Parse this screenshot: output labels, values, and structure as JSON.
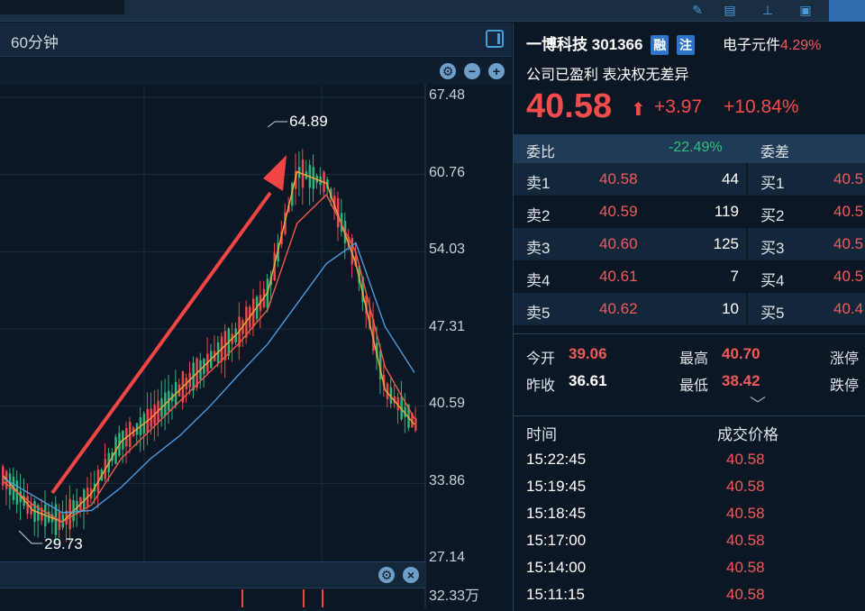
{
  "chart_panel": {
    "period": "60分钟",
    "y_ticks": [
      "67.48",
      "60.76",
      "54.03",
      "47.31",
      "40.59",
      "33.86",
      "27.14"
    ],
    "volume_tick": "32.33万",
    "annotation_high": "64.89",
    "annotation_low": "29.73"
  },
  "chart_data": {
    "type": "line",
    "title": "",
    "xlabel": "",
    "ylabel": "",
    "ylim": [
      27.14,
      67.48
    ],
    "grid": true,
    "x": [
      0,
      4,
      8,
      12,
      16,
      20,
      24,
      28,
      32,
      36,
      40,
      44,
      48,
      52,
      56
    ],
    "series": [
      {
        "values": [
          34.5,
          31.5,
          30.5,
          33.0,
          37.5,
          39.5,
          42.0,
          44.5,
          47.0,
          50.5,
          61.0,
          60.0,
          53.0,
          42.0,
          39.0
        ]
      },
      {
        "values": [
          34.0,
          32.0,
          30.5,
          32.0,
          36.0,
          38.5,
          41.0,
          43.5,
          46.0,
          49.0,
          56.5,
          59.0,
          54.0,
          44.0,
          39.5
        ]
      },
      {
        "values": [
          34.3,
          32.8,
          31.3,
          31.5,
          33.5,
          36.0,
          38.0,
          40.5,
          43.3,
          46.0,
          49.5,
          53.0,
          54.8,
          47.5,
          43.5
        ]
      }
    ],
    "annotations": [
      {
        "label": "64.89",
        "x": 36,
        "y": 64.89
      },
      {
        "label": "29.73",
        "x": 8,
        "y": 29.73
      }
    ]
  },
  "colors": {
    "up": "#e84a4a",
    "down": "#2fb47c",
    "ma_short": "#f2a83a",
    "ma_mid": "#f05a4a",
    "ma_long": "#4a9be0"
  },
  "stock": {
    "name": "一博科技",
    "code": "301366",
    "badge1": "融",
    "badge2": "注",
    "sector": "电子元件",
    "sector_pct": "4.29%",
    "status": "公司已盈利 表决权无差异",
    "price": "40.58",
    "change": "+3.97",
    "change_pct": "+10.84%"
  },
  "orderbook": {
    "ratio_label": "委比",
    "ratio_value": "-22.49%",
    "diff_label": "委差",
    "rows": [
      {
        "sell_label": "卖1",
        "sell_price": "40.58",
        "sell_vol": "44",
        "buy_label": "买1",
        "buy_price": "40.5"
      },
      {
        "sell_label": "卖2",
        "sell_price": "40.59",
        "sell_vol": "119",
        "buy_label": "买2",
        "buy_price": "40.5"
      },
      {
        "sell_label": "卖3",
        "sell_price": "40.60",
        "sell_vol": "125",
        "buy_label": "买3",
        "buy_price": "40.5"
      },
      {
        "sell_label": "卖4",
        "sell_price": "40.61",
        "sell_vol": "7",
        "buy_label": "买4",
        "buy_price": "40.5"
      },
      {
        "sell_label": "卖5",
        "sell_price": "40.62",
        "sell_vol": "10",
        "buy_label": "买5",
        "buy_price": "40.4"
      }
    ]
  },
  "stats": {
    "open_label": "今开",
    "open": "39.06",
    "high_label": "最高",
    "high": "40.70",
    "limit_up_label": "涨停",
    "prev_label": "昨收",
    "prev": "36.61",
    "low_label": "最低",
    "low": "38.42",
    "limit_down_label": "跌停"
  },
  "trades": {
    "col_time": "时间",
    "col_price": "成交价格",
    "rows": [
      {
        "time": "15:22:45",
        "price": "40.58"
      },
      {
        "time": "15:19:45",
        "price": "40.58"
      },
      {
        "time": "15:18:45",
        "price": "40.58"
      },
      {
        "time": "15:17:00",
        "price": "40.58"
      },
      {
        "time": "15:14:00",
        "price": "40.58"
      },
      {
        "time": "15:11:15",
        "price": "40.58"
      }
    ]
  }
}
